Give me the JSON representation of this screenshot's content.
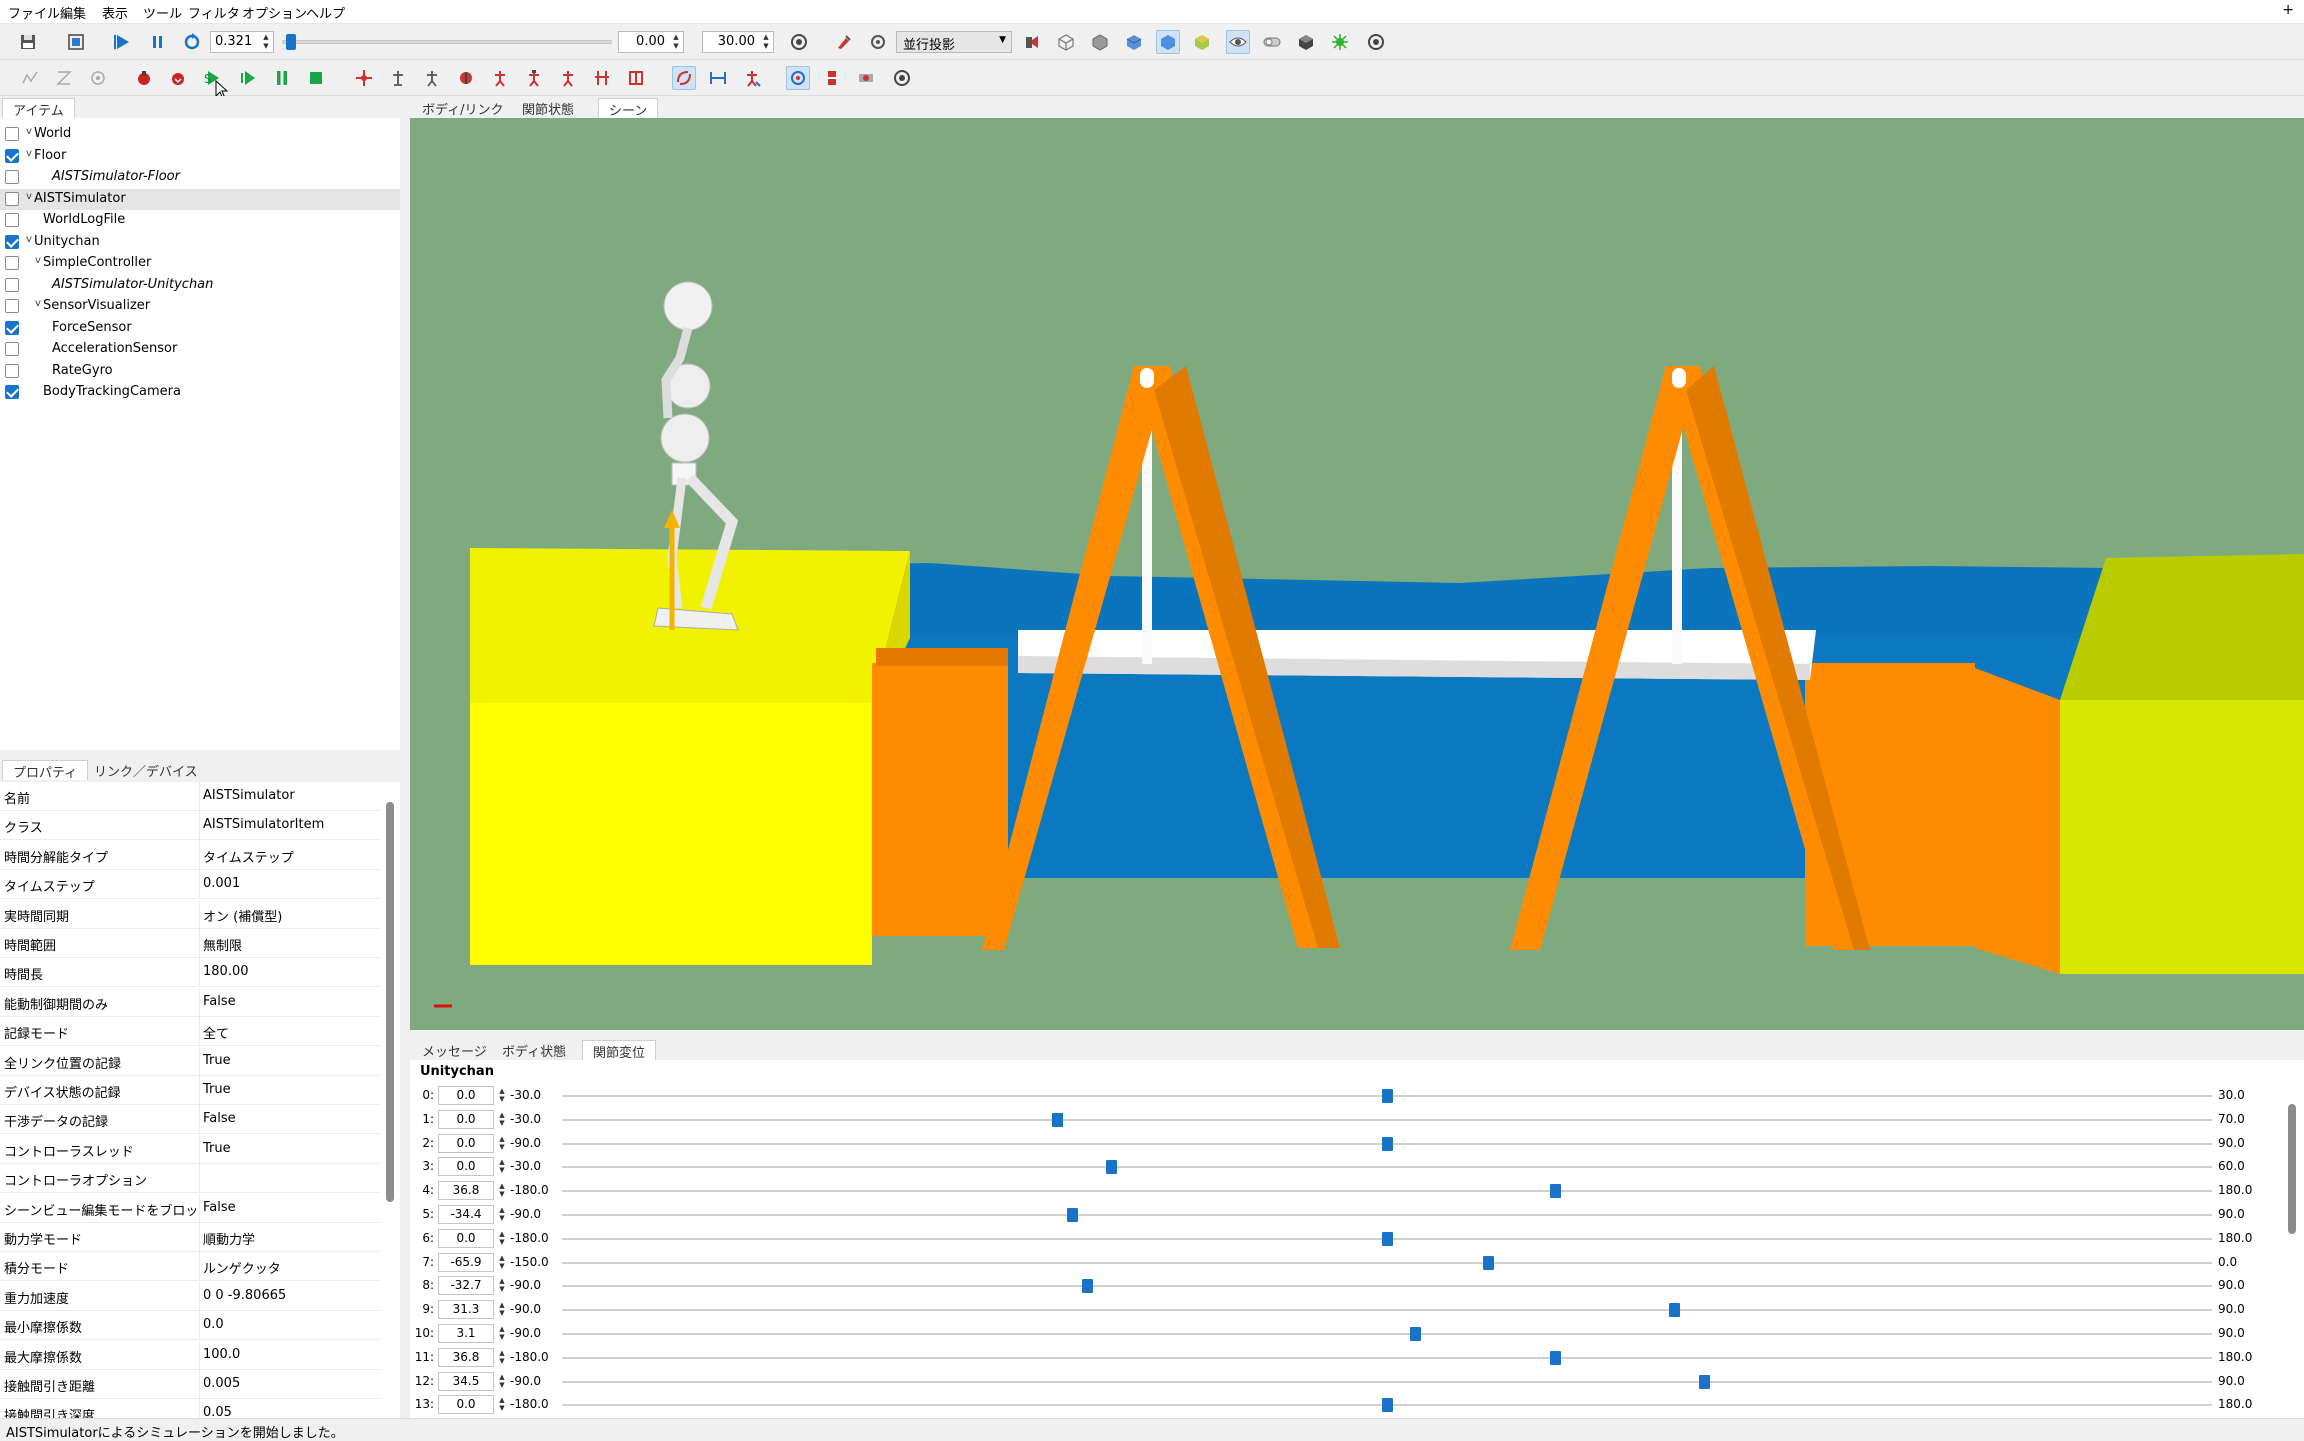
{
  "menu": [
    "ファイル",
    "編集",
    "表示",
    "ツール",
    "フィルタ",
    "オプション",
    "ヘルプ"
  ],
  "menu_extra": "+",
  "time": {
    "current": "0.321",
    "start": "0.00",
    "end": "30.00",
    "progress_fraction": 0.0107
  },
  "projection": "並行投影",
  "colors": {
    "accent": "#1a73c9",
    "viewport_bg": "#7faa7f",
    "yellow_block": "#f2f200",
    "orange": "#ff8c00",
    "water": "#0a75bd"
  },
  "items_panel": {
    "tab": "アイテム",
    "items": [
      {
        "label": "World",
        "checked": false,
        "expander": "v",
        "italic": false
      },
      {
        "label": "Floor",
        "checked": true,
        "expander": "v",
        "italic": false
      },
      {
        "label": "AISTSimulator-Floor",
        "checked": false,
        "expander": "",
        "italic": true
      },
      {
        "label": "AISTSimulator",
        "checked": false,
        "expander": "v",
        "italic": false,
        "selected": true
      },
      {
        "label": "WorldLogFile",
        "checked": false,
        "expander": "",
        "italic": false
      },
      {
        "label": "Unitychan",
        "checked": true,
        "expander": "v",
        "italic": false
      },
      {
        "label": "SimpleController",
        "checked": false,
        "expander": "v",
        "italic": false
      },
      {
        "label": "AISTSimulator-Unitychan",
        "checked": false,
        "expander": "",
        "italic": true
      },
      {
        "label": "SensorVisualizer",
        "checked": false,
        "expander": "v",
        "italic": false
      },
      {
        "label": "ForceSensor",
        "checked": true,
        "expander": "",
        "italic": false
      },
      {
        "label": "AccelerationSensor",
        "checked": false,
        "expander": "",
        "italic": false
      },
      {
        "label": "RateGyro",
        "checked": false,
        "expander": "",
        "italic": false
      },
      {
        "label": "BodyTrackingCamera",
        "checked": true,
        "expander": "",
        "italic": false
      }
    ]
  },
  "property_panel": {
    "tabs": [
      "プロパティ",
      "リンク／デバイス"
    ],
    "rows": [
      {
        "name": "名前",
        "value": "AISTSimulator"
      },
      {
        "name": "クラス",
        "value": "AISTSimulatorItem"
      },
      {
        "name": "時間分解能タイプ",
        "value": "タイムステップ"
      },
      {
        "name": "タイムステップ",
        "value": "0.001"
      },
      {
        "name": "実時間同期",
        "value": "オン (補償型)"
      },
      {
        "name": "時間範囲",
        "value": "無制限"
      },
      {
        "name": "時間長",
        "value": "180.00"
      },
      {
        "name": "能動制御期間のみ",
        "value": "False"
      },
      {
        "name": "記録モード",
        "value": "全て"
      },
      {
        "name": "全リンク位置の記録",
        "value": "True"
      },
      {
        "name": "デバイス状態の記録",
        "value": "True"
      },
      {
        "name": "干渉データの記録",
        "value": "False"
      },
      {
        "name": "コントローラスレッド",
        "value": "True"
      },
      {
        "name": "コントローラオプション",
        "value": ""
      },
      {
        "name": "シーンビュー編集モードをブロック",
        "value": "False"
      },
      {
        "name": "動力学モード",
        "value": "順動力学"
      },
      {
        "name": "積分モード",
        "value": "ルンゲクッタ"
      },
      {
        "name": "重力加速度",
        "value": "0 0 -9.80665"
      },
      {
        "name": "最小摩擦係数",
        "value": "0.0"
      },
      {
        "name": "最大摩擦係数",
        "value": "100.0"
      },
      {
        "name": "接触間引き距離",
        "value": "0.005"
      },
      {
        "name": "接触間引き深度",
        "value": "0.05"
      }
    ]
  },
  "view_tabs": [
    "ボディ/リンク",
    "関節状態",
    "シーン"
  ],
  "bottom_tabs": [
    "メッセージ",
    "ボディ状態",
    "関節変位"
  ],
  "joint_panel": {
    "title": "Unitychan",
    "joints": [
      {
        "index": "0:",
        "value": "0.0",
        "min": "-30.0",
        "max": "30.0",
        "fraction": 0.5
      },
      {
        "index": "1:",
        "value": "0.0",
        "min": "-30.0",
        "max": "70.0",
        "fraction": 0.3
      },
      {
        "index": "2:",
        "value": "0.0",
        "min": "-90.0",
        "max": "90.0",
        "fraction": 0.5
      },
      {
        "index": "3:",
        "value": "0.0",
        "min": "-30.0",
        "max": "60.0",
        "fraction": 0.333
      },
      {
        "index": "4:",
        "value": "36.8",
        "min": "-180.0",
        "max": "180.0",
        "fraction": 0.602
      },
      {
        "index": "5:",
        "value": "-34.4",
        "min": "-90.0",
        "max": "90.0",
        "fraction": 0.309
      },
      {
        "index": "6:",
        "value": "0.0",
        "min": "-180.0",
        "max": "180.0",
        "fraction": 0.5
      },
      {
        "index": "7:",
        "value": "-65.9",
        "min": "-150.0",
        "max": "0.0",
        "fraction": 0.561
      },
      {
        "index": "8:",
        "value": "-32.7",
        "min": "-90.0",
        "max": "90.0",
        "fraction": 0.318
      },
      {
        "index": "9:",
        "value": "31.3",
        "min": "-90.0",
        "max": "90.0",
        "fraction": 0.674
      },
      {
        "index": "10:",
        "value": "3.1",
        "min": "-90.0",
        "max": "90.0",
        "fraction": 0.517
      },
      {
        "index": "11:",
        "value": "36.8",
        "min": "-180.0",
        "max": "180.0",
        "fraction": 0.602
      },
      {
        "index": "12:",
        "value": "34.5",
        "min": "-90.0",
        "max": "90.0",
        "fraction": 0.692
      },
      {
        "index": "13:",
        "value": "0.0",
        "min": "-180.0",
        "max": "180.0",
        "fraction": 0.5
      }
    ]
  },
  "status_message": "AISTSimulatorによるシミュレーションを開始しました。"
}
